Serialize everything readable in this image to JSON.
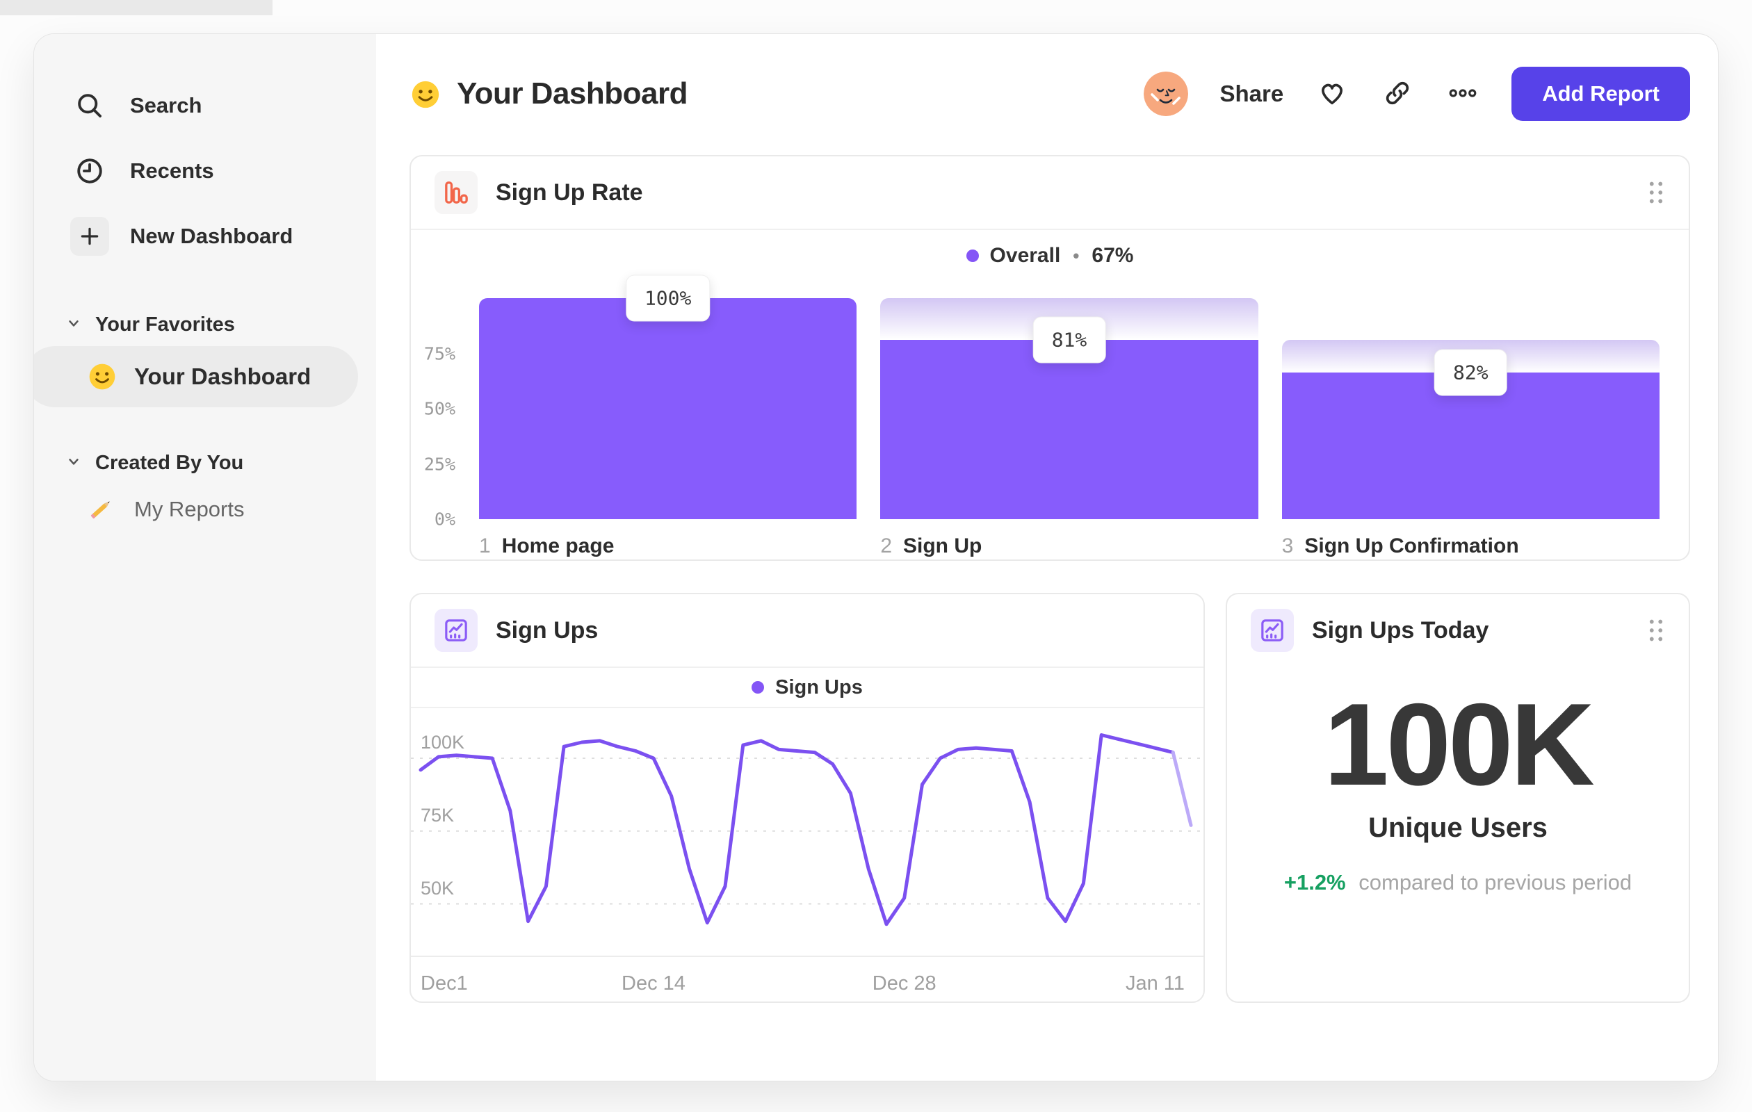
{
  "sidebar": {
    "items": [
      {
        "label": "Search",
        "icon": "search-icon"
      },
      {
        "label": "Recents",
        "icon": "clock-icon"
      },
      {
        "label": "New Dashboard",
        "icon": "plus-icon"
      }
    ],
    "sections": [
      {
        "label": "Your Favorites"
      },
      {
        "label": "Created By You"
      }
    ],
    "favorites": [
      {
        "label": "Your Dashboard",
        "icon": "smiley-emoji",
        "selected": true
      }
    ],
    "created": [
      {
        "label": "My Reports",
        "icon": "pencil-emoji"
      }
    ]
  },
  "header": {
    "title": "Your Dashboard",
    "title_icon": "smiley-emoji",
    "share_label": "Share",
    "add_report_label": "Add Report"
  },
  "colors": {
    "accent_purple": "#5742e9",
    "bar_purple": "#875cfc",
    "line_purple": "#7b50f0",
    "line_purple_light": "#bcaaf8",
    "legend_dot": "#8455f6",
    "funnel_icon_orange": "#f2664a",
    "icon_purple": "#8b5cf6",
    "delta_green": "#16a061",
    "sidebar_bg": "#f6f6f6"
  },
  "chart_data": [
    {
      "type": "bar",
      "subtype": "funnel",
      "title": "Sign Up Rate",
      "overall_label": "Overall",
      "legend_separator": "•",
      "overall_value": "67%",
      "ylim": [
        0,
        100
      ],
      "y_ticks_pct": [
        0,
        25,
        50,
        75
      ],
      "steps": [
        {
          "n": "1",
          "label": "Home page",
          "value_label": "100%",
          "conversion_from_previous_pct": 100,
          "absolute_pct": 100
        },
        {
          "n": "2",
          "label": "Sign Up",
          "value_label": "81%",
          "conversion_from_previous_pct": 81,
          "absolute_pct": 81
        },
        {
          "n": "3",
          "label": "Sign Up Confirmation",
          "value_label": "82%",
          "conversion_from_previous_pct": 82,
          "absolute_pct": 66.4
        }
      ]
    },
    {
      "type": "line",
      "title": "Sign Ups",
      "legend_label": "Sign Ups",
      "x_unit": "day",
      "x_ticks": [
        {
          "label": "Dec1",
          "i": 0
        },
        {
          "label": "Dec 14",
          "i": 13
        },
        {
          "label": "Dec 28",
          "i": 27
        },
        {
          "label": "Jan 11",
          "i": 41
        }
      ],
      "y_ticks": [
        {
          "label": "100K",
          "v": 100
        },
        {
          "label": "75K",
          "v": 75
        },
        {
          "label": "50K",
          "v": 50
        }
      ],
      "y_unit": "K",
      "values": [
        96,
        100.5,
        101,
        100.5,
        100,
        82,
        44,
        56,
        104,
        105.5,
        106,
        104,
        102.5,
        100,
        87,
        62,
        43.5,
        56,
        104.5,
        106,
        103,
        102.5,
        102,
        98,
        88,
        62,
        43,
        52,
        91,
        100,
        103,
        103.5,
        103,
        102.5,
        85,
        52,
        44,
        57,
        108,
        106.5,
        105,
        103.5,
        102,
        77
      ],
      "incomplete_from_index": 42,
      "grid": "dashed-horizontal"
    },
    {
      "type": "stat",
      "title": "Sign Ups Today",
      "value": "100K",
      "label": "Unique Users",
      "delta_pct": "+1.2%",
      "delta_note": "compared to previous period"
    }
  ]
}
